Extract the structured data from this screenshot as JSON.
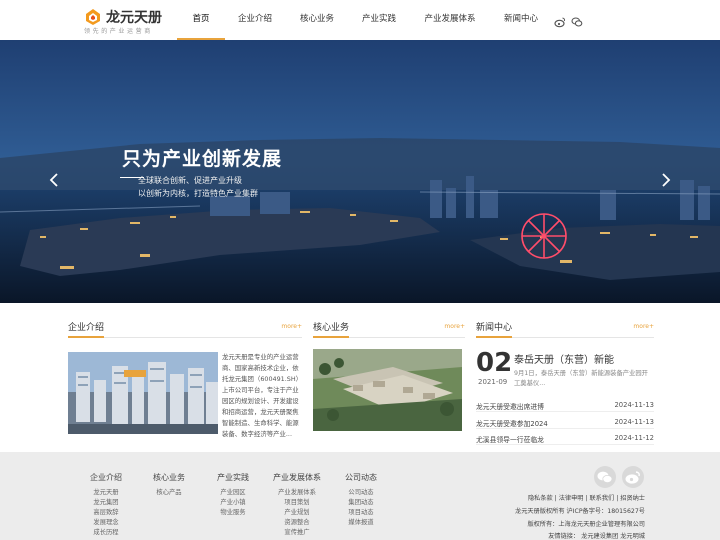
{
  "brand": {
    "name": "龙元天册",
    "slogan": "领先的产业运营商"
  },
  "nav": [
    {
      "label": "首页",
      "active": true
    },
    {
      "label": "企业介绍"
    },
    {
      "label": "核心业务"
    },
    {
      "label": "产业实践"
    },
    {
      "label": "产业发展体系"
    },
    {
      "label": "新闻中心"
    }
  ],
  "social": [
    "weibo-icon",
    "wechat-icon"
  ],
  "banner": {
    "title": "只为产业创新发展",
    "sub1": "全球联合创新、促进产业升级",
    "sub2": "以创新为内核，打造特色产业集群",
    "slide_count": 7,
    "active_slide": 1
  },
  "sections": {
    "about": {
      "title": "企业介绍",
      "more": "more+",
      "text": "龙元天册是专业的产业运营商、国家高新技术企业，依托龙元集团（600491.SH）上市公司平台，专注于产业园区的规划设计、开发建设和招商运营，龙元天册聚焦智能制造、生命科学、能源装备、数字经济等产业..."
    },
    "business": {
      "title": "核心业务",
      "more": "more+"
    },
    "news": {
      "title": "新闻中心",
      "more": "more+"
    }
  },
  "news_featured": {
    "day": "02",
    "year_month": "2021-09",
    "title": "泰岳天册（东营）新能",
    "desc": "9月1日，泰岳天册（东营）新能源装备产业园开工奠基仪..."
  },
  "news_list": [
    {
      "title": "龙元天册受邀出席进博",
      "date": "2024-11-13"
    },
    {
      "title": "龙元天册受邀参加2024",
      "date": "2024-11-13"
    },
    {
      "title": "尤溪县领导一行莅临龙",
      "date": "2024-11-12"
    }
  ],
  "footer": {
    "columns": [
      {
        "title": "企业介绍",
        "links": [
          "龙元天册",
          "龙元集团",
          "高层致辞",
          "发展理念",
          "成长历程"
        ]
      },
      {
        "title": "核心业务",
        "links": [
          "核心产品"
        ]
      },
      {
        "title": "产业实践",
        "links": [
          "产业园区",
          "产业小镇",
          "物业服务"
        ]
      },
      {
        "title": "产业发展体系",
        "links": [
          "产业发展体系",
          "项目策划",
          "产业规划",
          "资源整合",
          "宣传推广"
        ]
      },
      {
        "title": "公司动态",
        "links": [
          "公司动态",
          "集团动态",
          "项目动态",
          "媒体报道"
        ]
      }
    ],
    "legal": "隐私条款 | 法律申明 | 联系我们 | 招贤纳士",
    "icp": "龙元天册版权所有   沪ICP备字号：18015627号",
    "copyright": "版权所有：上海龙元天册企业管理有限公司",
    "friend_links": "友情链接：  龙元建设集团  龙元明城"
  },
  "colors": {
    "accent": "#e8a33c",
    "footer_bg": "#ececec"
  }
}
